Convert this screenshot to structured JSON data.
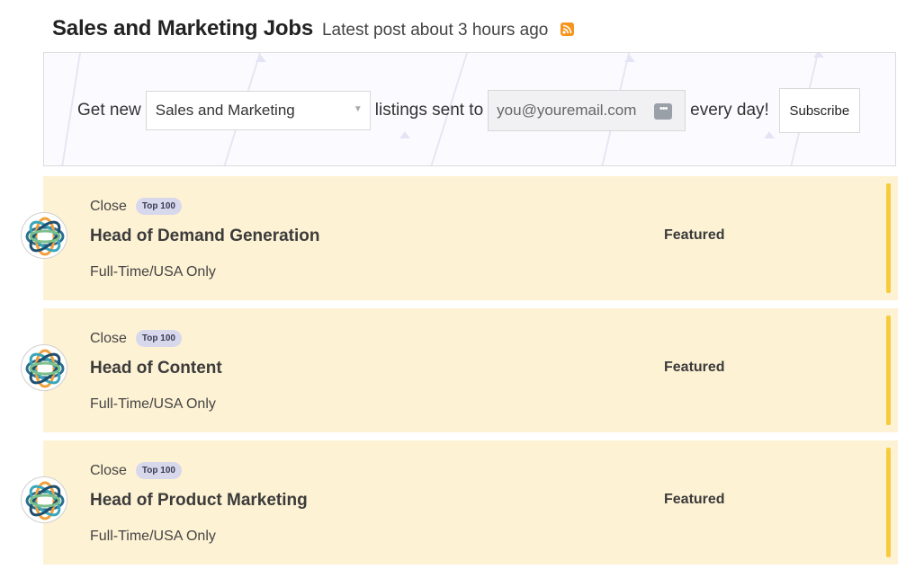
{
  "header": {
    "title": "Sales and Marketing Jobs",
    "latest": "Latest post about 3 hours ago",
    "rss_icon": "rss-icon"
  },
  "subscribe": {
    "prefix": "Get new",
    "category_selected": "Sales and Marketing",
    "middle": "listings sent to",
    "email_placeholder": "you@youremail.com",
    "suffix": "every day!",
    "button": "Subscribe"
  },
  "colors": {
    "job_bg": "#fef2d4",
    "featured_bar": "#f7cc3c",
    "rss": "#f7941d"
  },
  "jobs": [
    {
      "company": "Close",
      "badge": "Top 100",
      "title": "Head of Demand Generation",
      "meta": "Full-Time/USA Only",
      "featured": "Featured"
    },
    {
      "company": "Close",
      "badge": "Top 100",
      "title": "Head of Content",
      "meta": "Full-Time/USA Only",
      "featured": "Featured"
    },
    {
      "company": "Close",
      "badge": "Top 100",
      "title": "Head of Product Marketing",
      "meta": "Full-Time/USA Only",
      "featured": "Featured"
    }
  ]
}
